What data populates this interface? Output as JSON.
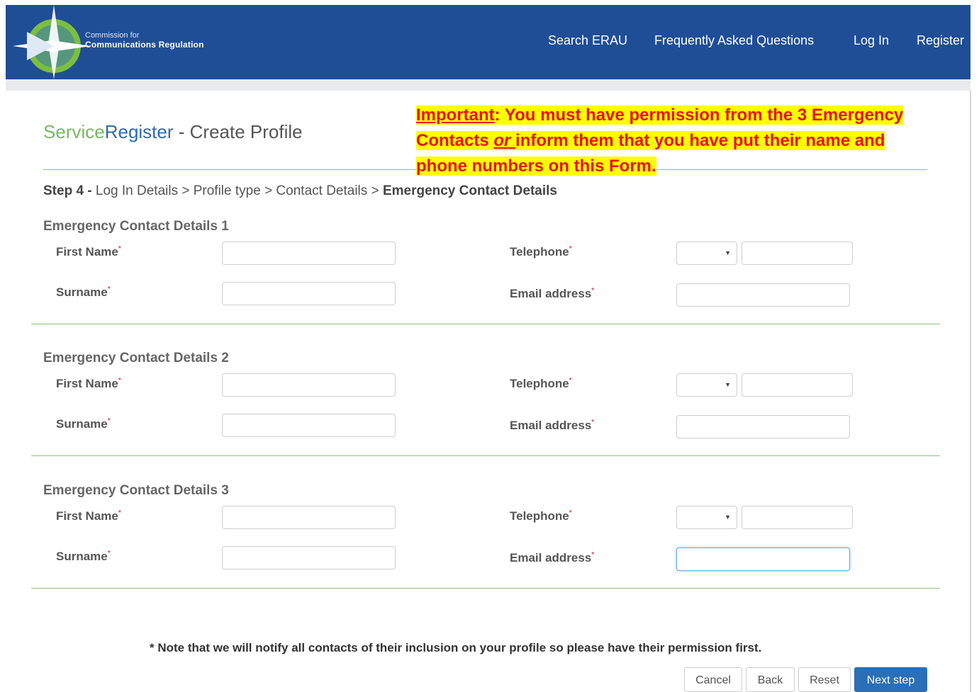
{
  "header": {
    "org_line1": "Commission for",
    "org_line2": "Communications Regulation",
    "nav": [
      "Search ERAU",
      "Frequently Asked Questions",
      "Log In",
      "Register"
    ],
    "color": "#1f4e97"
  },
  "title": {
    "part1": "Service",
    "part2": "Register",
    "part3": " - Create Profile"
  },
  "notice": {
    "important": "Important",
    "line1_rest": ":  You must have permission from the 3 Emergency",
    "line2a": "Contacts ",
    "line2_or": "or ",
    "line2b": "inform them that you have put their name and",
    "line3": "phone numbers on this Form."
  },
  "breadcrumb": {
    "step": "Step 4 -",
    "path": " Log In Details > Profile type > Contact Details > ",
    "current": "Emergency Contact Details"
  },
  "sections": [
    {
      "heading": "Emergency Contact Details 1"
    },
    {
      "heading": "Emergency Contact Details 2"
    },
    {
      "heading": "Emergency Contact Details 3"
    }
  ],
  "labels": {
    "first_name": "First Name",
    "surname": "Surname",
    "telephone": "Telephone",
    "email": "Email address",
    "required": "*"
  },
  "note": "* Note that we will notify all contacts of their inclusion on your profile so please have their permission first.",
  "buttons": {
    "cancel": "Cancel",
    "back": "Back",
    "reset": "Reset",
    "next": "Next step"
  }
}
